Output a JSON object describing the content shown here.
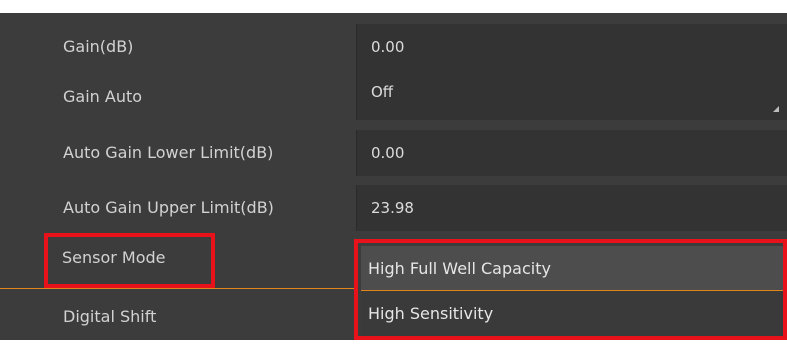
{
  "properties": [
    {
      "label": "Gain(dB)",
      "value": "0.00"
    },
    {
      "label": "Gain Auto",
      "value": "Off"
    },
    {
      "label": "Auto Gain Lower Limit(dB)",
      "value": "0.00"
    },
    {
      "label": "Auto Gain Upper Limit(dB)",
      "value": "23.98"
    },
    {
      "label": "Sensor Mode",
      "value": "High Full Well Capacity"
    },
    {
      "label": "Digital Shift",
      "value": ""
    }
  ],
  "sensor_mode_dropdown": {
    "options": [
      "High Full Well Capacity",
      "High Sensitivity"
    ],
    "selected": "High Full Well Capacity"
  },
  "colors": {
    "panel_bg": "#3c3c3c",
    "value_bg": "#333333",
    "highlight_red": "#e8131a",
    "selection_orange": "#e2841c"
  }
}
